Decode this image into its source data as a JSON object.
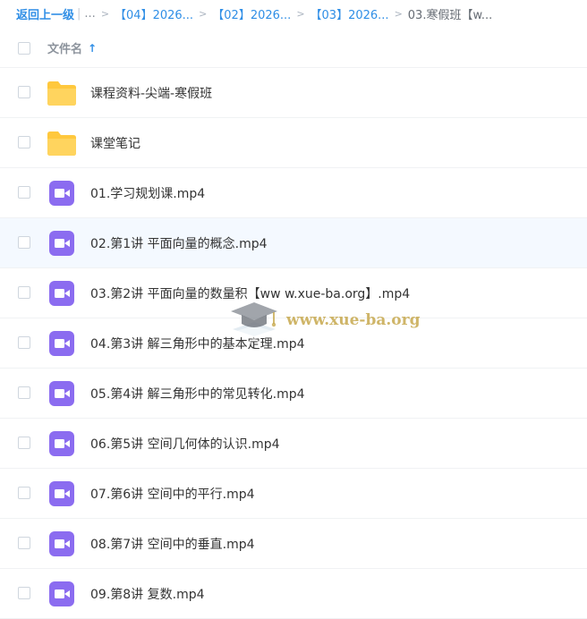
{
  "breadcrumb": {
    "back": "返回上一级",
    "divider": "|",
    "ellipsis": "...",
    "separator": ">",
    "items": [
      "【04】2026...",
      "【02】2026...",
      "【03】2026..."
    ],
    "current": "03.寒假班【w..."
  },
  "header": {
    "name_label": "文件名",
    "sort_glyph": "↑"
  },
  "files": [
    {
      "type": "folder",
      "name": "课程资料-尖端-寒假班"
    },
    {
      "type": "folder",
      "name": "课堂笔记"
    },
    {
      "type": "video",
      "name": "01.学习规划课.mp4"
    },
    {
      "type": "video",
      "name": "02.第1讲 平面向量的概念.mp4"
    },
    {
      "type": "video",
      "name": "03.第2讲 平面向量的数量积【ww w.xue-ba.org】.mp4"
    },
    {
      "type": "video",
      "name": "04.第3讲 解三角形中的基本定理.mp4"
    },
    {
      "type": "video",
      "name": "05.第4讲 解三角形中的常见转化.mp4"
    },
    {
      "type": "video",
      "name": "06.第5讲 空间几何体的认识.mp4"
    },
    {
      "type": "video",
      "name": "07.第6讲 空间中的平行.mp4"
    },
    {
      "type": "video",
      "name": "08.第7讲 空间中的垂直.mp4"
    },
    {
      "type": "video",
      "name": "09.第8讲 复数.mp4"
    }
  ],
  "watermark": {
    "text": "www.xue-ba.org"
  },
  "colors": {
    "link": "#2f8ee6",
    "folder": "#ffc83d",
    "video": "#8b6cf0",
    "row_hover": "#f4f9ff"
  }
}
